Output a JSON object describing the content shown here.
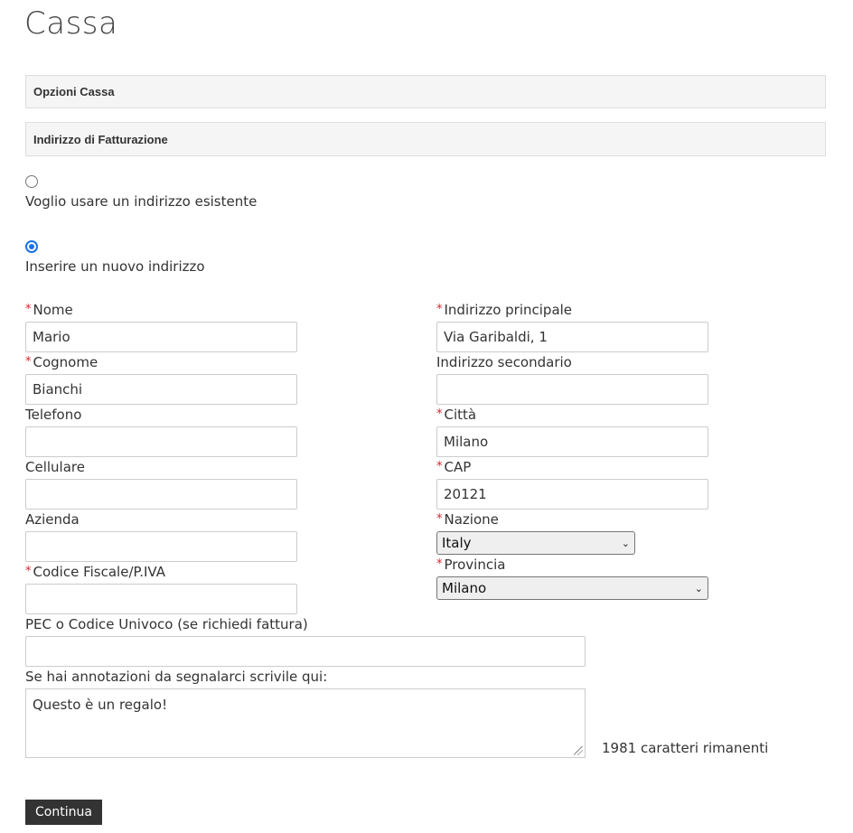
{
  "page": {
    "title": "Cassa"
  },
  "panels": {
    "options": "Opzioni Cassa",
    "billing": "Indirizzo di Fatturazione"
  },
  "address_choice": {
    "existing_label": "Voglio usare un indirizzo esistente",
    "new_label": "Inserire un nuovo indirizzo",
    "selected": "new"
  },
  "left": {
    "first_name": {
      "label": "Nome",
      "value": "Mario"
    },
    "last_name": {
      "label": "Cognome",
      "value": "Bianchi"
    },
    "phone": {
      "label": "Telefono",
      "value": ""
    },
    "mobile": {
      "label": "Cellulare",
      "value": ""
    },
    "company": {
      "label": "Azienda",
      "value": ""
    },
    "tax_code": {
      "label": "Codice Fiscale/P.IVA",
      "value": ""
    }
  },
  "right": {
    "address1": {
      "label": "Indirizzo principale",
      "value": "Via Garibaldi, 1"
    },
    "address2": {
      "label": "Indirizzo secondario",
      "value": ""
    },
    "city": {
      "label": "Città",
      "value": "Milano"
    },
    "zip": {
      "label": "CAP",
      "value": "20121"
    },
    "country": {
      "label": "Nazione",
      "value": "Italy"
    },
    "province": {
      "label": "Provincia",
      "value": "Milano"
    }
  },
  "pec": {
    "label": "PEC o Codice Univoco (se richiedi fattura)",
    "value": ""
  },
  "notes": {
    "label": "Se hai annotazioni da segnalarci scrivile qui:",
    "value": "Questo è un regalo!",
    "counter": "1981 caratteri rimanenti"
  },
  "submit": {
    "label": "Continua"
  },
  "colors": {
    "required": "#d9232e",
    "radio_checked": "#1a73e8",
    "button_bg": "#333333"
  }
}
